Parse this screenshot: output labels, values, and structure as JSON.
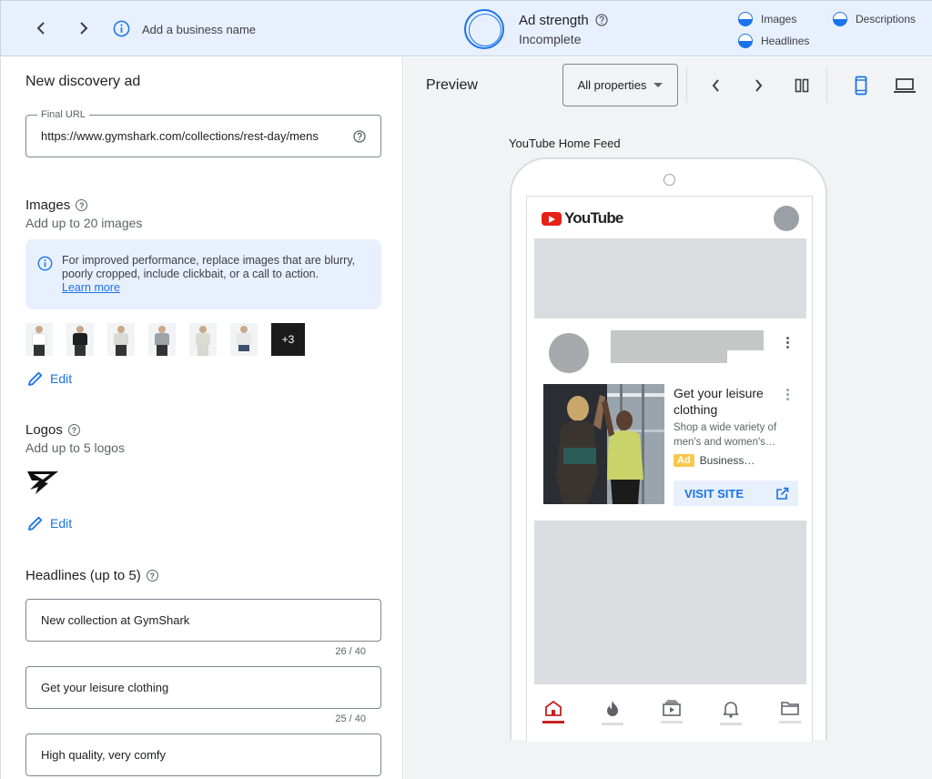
{
  "topbar": {
    "business_name_prompt": "Add a business name",
    "ad_strength": {
      "title": "Ad strength",
      "status": "Incomplete",
      "meters": [
        "Images",
        "Headlines",
        "Descriptions"
      ]
    }
  },
  "editor": {
    "title": "New discovery ad",
    "final_url": {
      "label": "Final URL",
      "value": "https://www.gymshark.com/collections/rest-day/mens"
    },
    "images": {
      "title": "Images",
      "subtitle": "Add up to 20 images",
      "notice": "For improved performance, replace images that are blurry, poorly cropped, include clickbait, or a call to action.",
      "notice_link": "Learn more",
      "thumbnails": [
        "#ffffff",
        "#1f1f1f",
        "#d9d9d6",
        "#9ea3a8",
        "#dcdcd2",
        "#e8e8e8"
      ],
      "more_count": "+3",
      "edit_label": "Edit"
    },
    "logos": {
      "title": "Logos",
      "subtitle": "Add up to 5 logos",
      "edit_label": "Edit"
    },
    "headlines": {
      "title": "Headlines (up to 5)",
      "items": [
        {
          "text": "New collection at GymShark",
          "counter": "26 / 40"
        },
        {
          "text": "Get your leisure clothing",
          "counter": "25 / 40"
        },
        {
          "text": "High quality, very comfy",
          "counter": ""
        }
      ]
    }
  },
  "preview": {
    "title": "Preview",
    "dropdown": "All properties",
    "feed_label": "YouTube Home Feed",
    "youtube_word": "YouTube",
    "ad": {
      "headline": "Get your leisure clothing",
      "description": "Shop a wide variety of men's and women's…",
      "badge": "Ad",
      "business": "Business…",
      "cta": "VISIT SITE"
    }
  },
  "colors": {
    "accent": "#1a73e8",
    "topbar_bg": "#e8f0fe",
    "preview_bg": "#f1f3f4",
    "youtube_red": "#e62117"
  }
}
